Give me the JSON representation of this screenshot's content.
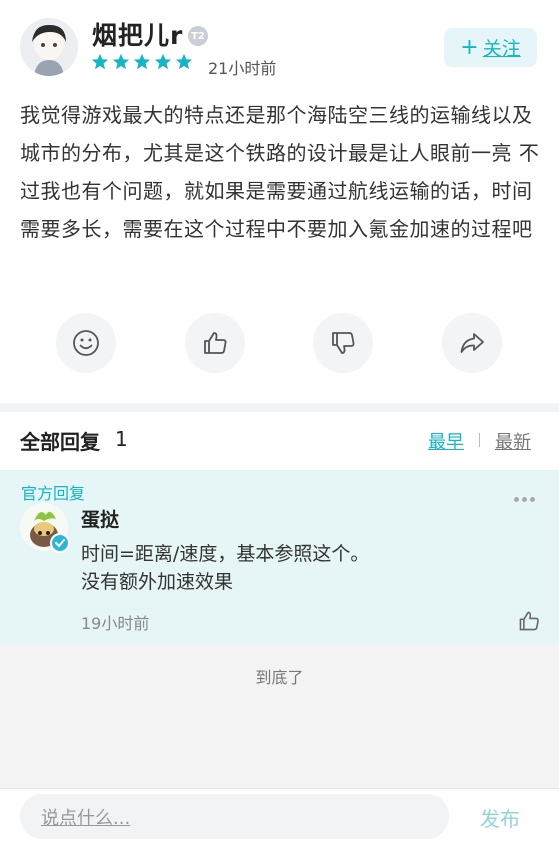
{
  "author": {
    "name": "烟把儿r",
    "level_badge": "T2",
    "rating_stars": 5,
    "time_ago": "21小时前"
  },
  "follow_label": "关注",
  "review_text": "我觉得游戏最大的特点还是那个海陆空三线的运输线以及城市的分布，尤其是这个铁路的设计最是让人眼前一亮 不过我也有个问题，就如果是需要通过航线运输的话，时间需要多长，需要在这个过程中不要加入氪金加速的过程吧",
  "replies": {
    "title": "全部回复",
    "count": "1",
    "sort_earliest": "最早",
    "sort_newest": "最新"
  },
  "official_reply": {
    "tag": "官方回复",
    "name": "蛋挞",
    "text_line1": "时间=距离/速度，基本参照这个。",
    "text_line2": "没有额外加速效果",
    "time_ago": "19小时前"
  },
  "end_text": "到底了",
  "input": {
    "placeholder": "说点什么..."
  },
  "publish_label": "发布",
  "colors": {
    "accent": "#15b5c5",
    "star": "#15b5c5",
    "official_bg": "#e6f6f7"
  },
  "icons": [
    "avatar",
    "star-icon",
    "smile-icon",
    "thumbs-up-icon",
    "thumbs-down-icon",
    "share-icon",
    "more-icon",
    "verified-icon"
  ]
}
